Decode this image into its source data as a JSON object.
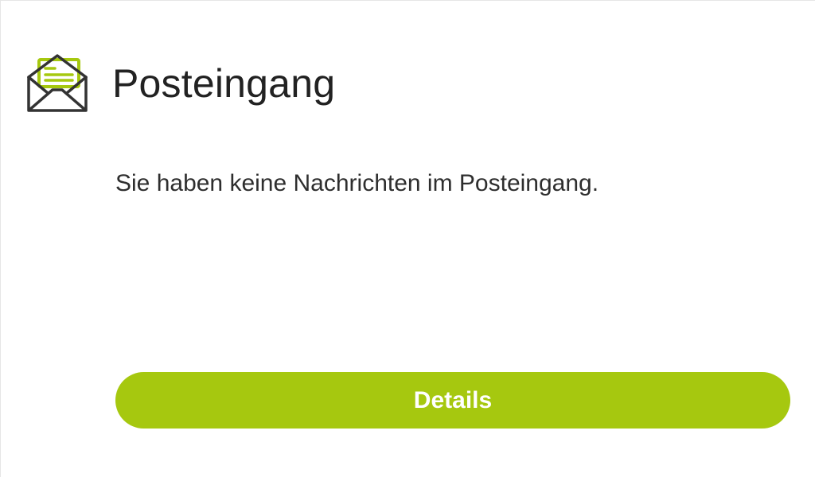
{
  "inbox": {
    "title": "Posteingang",
    "empty_message": "Sie haben keine Nachrichten im Posteingang.",
    "details_label": "Details",
    "icon": "open-envelope-icon"
  },
  "colors": {
    "accent": "#a6c80f",
    "icon_stroke": "#333333",
    "text": "#222222",
    "button_text": "#ffffff"
  }
}
